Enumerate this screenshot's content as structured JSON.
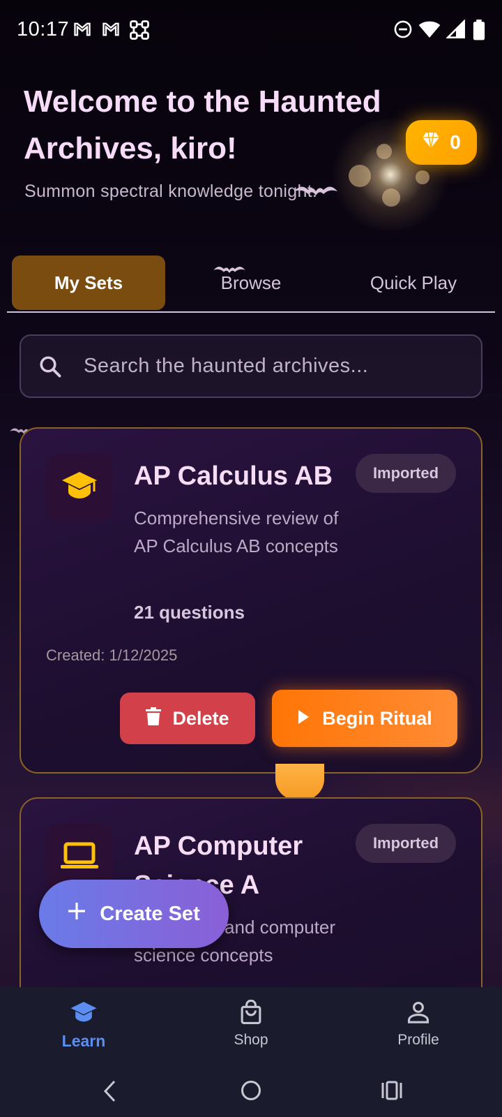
{
  "status_bar": {
    "time": "10:17",
    "left_icons": [
      "gmail-icon",
      "gmail-icon",
      "app-grid-icon"
    ],
    "right_icons": [
      "do-not-disturb-icon",
      "wifi-icon",
      "signal-icon",
      "battery-icon"
    ]
  },
  "header": {
    "welcome": "Welcome to the Haunted Archives, kiro!",
    "subtitle": "Summon spectral knowledge tonight.",
    "gems": "0",
    "gem_icon": "gem-icon"
  },
  "tabs": [
    {
      "label": "My Sets",
      "active": true
    },
    {
      "label": "Browse",
      "active": false
    },
    {
      "label": "Quick Play",
      "active": false
    }
  ],
  "search": {
    "placeholder": "Search the haunted archives..."
  },
  "sets": [
    {
      "icon": "graduation-cap-icon",
      "title": "AP Calculus AB",
      "badge": "Imported",
      "description": "Comprehensive review of AP Calculus AB concepts",
      "count": "21 questions",
      "created": "Created: 1/12/2025",
      "delete_label": "Delete",
      "play_label": "Begin Ritual"
    },
    {
      "icon": "laptop-icon",
      "title": "AP Computer Science A",
      "badge": "Imported",
      "description": "...ramming and computer science concepts"
    }
  ],
  "fab": {
    "label": "Create Set"
  },
  "bottom_nav": [
    {
      "label": "Learn",
      "icon": "school-icon",
      "active": true
    },
    {
      "label": "Shop",
      "icon": "shopping-bag-icon",
      "active": false
    },
    {
      "label": "Profile",
      "icon": "person-icon",
      "active": false
    }
  ],
  "colors": {
    "accent_tab": "#7b4c0f",
    "gem_badge": "#ffb400",
    "delete": "#d2404a",
    "ritual": "#ff7505",
    "nav_active": "#5b8ef0"
  }
}
